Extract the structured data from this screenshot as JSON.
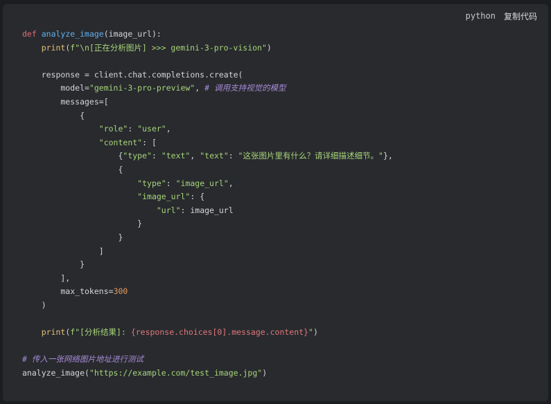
{
  "header": {
    "language": "python",
    "copy_label": "复制代码"
  },
  "colors": {
    "background": "#282a2e",
    "keyword": "#e06c75",
    "function": "#61afef",
    "builtin": "#e5c07b",
    "string": "#a8d47a",
    "number": "#e59a5e",
    "comment": "#a88bd6",
    "text": "#d4d6d9"
  },
  "code": {
    "lines": [
      [
        {
          "t": "kw",
          "s": "def"
        },
        {
          "t": "plain",
          "s": " "
        },
        {
          "t": "fn",
          "s": "analyze_image"
        },
        {
          "t": "plain",
          "s": "(image_url):"
        }
      ],
      [
        {
          "t": "plain",
          "s": "    "
        },
        {
          "t": "builtin",
          "s": "print"
        },
        {
          "t": "plain",
          "s": "("
        },
        {
          "t": "str",
          "s": "f\"\\n[正在分析图片] >>> gemini-3-pro-vision\""
        },
        {
          "t": "plain",
          "s": ")"
        }
      ],
      [],
      [
        {
          "t": "plain",
          "s": "    response = client.chat.completions.create("
        }
      ],
      [
        {
          "t": "plain",
          "s": "        model="
        },
        {
          "t": "str",
          "s": "\"gemini-3-pro-preview\""
        },
        {
          "t": "plain",
          "s": ", "
        },
        {
          "t": "comment",
          "s": "# 调用支持视觉的模型"
        }
      ],
      [
        {
          "t": "plain",
          "s": "        messages=["
        }
      ],
      [
        {
          "t": "plain",
          "s": "            {"
        }
      ],
      [
        {
          "t": "plain",
          "s": "                "
        },
        {
          "t": "str",
          "s": "\"role\""
        },
        {
          "t": "plain",
          "s": ": "
        },
        {
          "t": "str",
          "s": "\"user\""
        },
        {
          "t": "plain",
          "s": ","
        }
      ],
      [
        {
          "t": "plain",
          "s": "                "
        },
        {
          "t": "str",
          "s": "\"content\""
        },
        {
          "t": "plain",
          "s": ": ["
        }
      ],
      [
        {
          "t": "plain",
          "s": "                    {"
        },
        {
          "t": "str",
          "s": "\"type\""
        },
        {
          "t": "plain",
          "s": ": "
        },
        {
          "t": "str",
          "s": "\"text\""
        },
        {
          "t": "plain",
          "s": ", "
        },
        {
          "t": "str",
          "s": "\"text\""
        },
        {
          "t": "plain",
          "s": ": "
        },
        {
          "t": "str",
          "s": "\"这张图片里有什么？请详细描述细节。\""
        },
        {
          "t": "plain",
          "s": "},"
        }
      ],
      [
        {
          "t": "plain",
          "s": "                    {"
        }
      ],
      [
        {
          "t": "plain",
          "s": "                        "
        },
        {
          "t": "str",
          "s": "\"type\""
        },
        {
          "t": "plain",
          "s": ": "
        },
        {
          "t": "str",
          "s": "\"image_url\""
        },
        {
          "t": "plain",
          "s": ","
        }
      ],
      [
        {
          "t": "plain",
          "s": "                        "
        },
        {
          "t": "str",
          "s": "\"image_url\""
        },
        {
          "t": "plain",
          "s": ": {"
        }
      ],
      [
        {
          "t": "plain",
          "s": "                            "
        },
        {
          "t": "str",
          "s": "\"url\""
        },
        {
          "t": "plain",
          "s": ": image_url"
        }
      ],
      [
        {
          "t": "plain",
          "s": "                        }"
        }
      ],
      [
        {
          "t": "plain",
          "s": "                    }"
        }
      ],
      [
        {
          "t": "plain",
          "s": "                ]"
        }
      ],
      [
        {
          "t": "plain",
          "s": "            }"
        }
      ],
      [
        {
          "t": "plain",
          "s": "        ],"
        }
      ],
      [
        {
          "t": "plain",
          "s": "        max_tokens="
        },
        {
          "t": "num",
          "s": "300"
        }
      ],
      [
        {
          "t": "plain",
          "s": "    )"
        }
      ],
      [],
      [
        {
          "t": "plain",
          "s": "    "
        },
        {
          "t": "builtin",
          "s": "print"
        },
        {
          "t": "plain",
          "s": "("
        },
        {
          "t": "str",
          "s": "f\"[分析结果]: "
        },
        {
          "t": "fexpr",
          "s": "{response.choices[0].message.content}"
        },
        {
          "t": "str",
          "s": "\""
        },
        {
          "t": "plain",
          "s": ")"
        }
      ],
      [],
      [
        {
          "t": "comment",
          "s": "# 传入一张网络图片地址进行测试"
        }
      ],
      [
        {
          "t": "plain",
          "s": "analyze_image("
        },
        {
          "t": "str",
          "s": "\"https://example.com/test_image.jpg\""
        },
        {
          "t": "plain",
          "s": ")"
        }
      ]
    ]
  }
}
